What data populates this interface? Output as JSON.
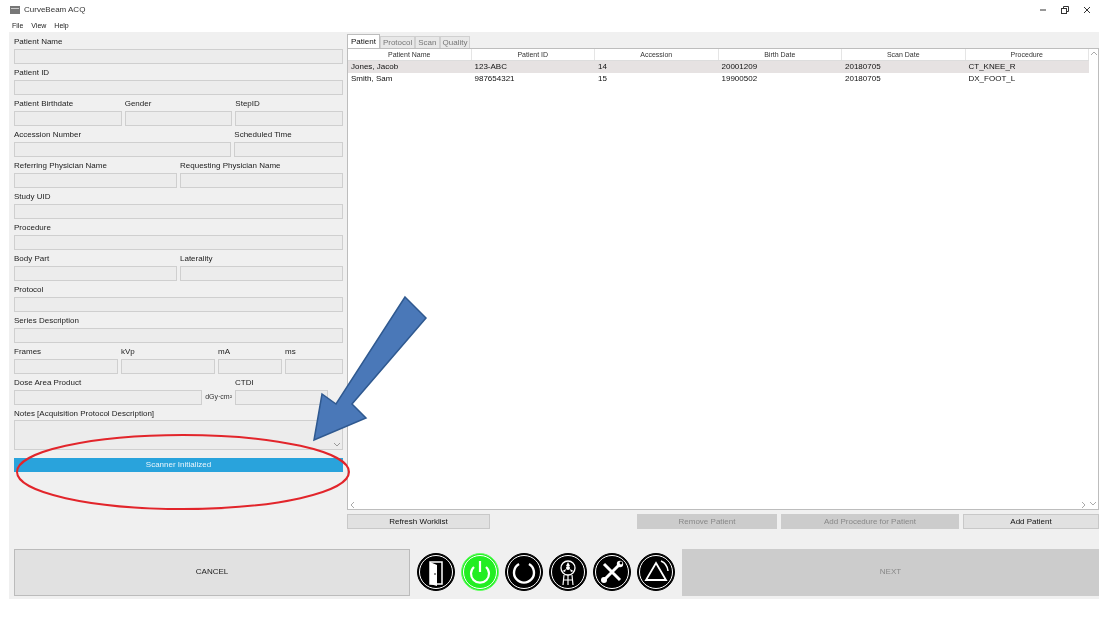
{
  "window": {
    "title": "CurveBeam ACQ"
  },
  "menu": [
    "File",
    "View",
    "Help"
  ],
  "form": {
    "lines": [
      {
        "fields": [
          {
            "label": "Patient Name"
          }
        ]
      },
      {
        "fields": [
          {
            "label": "Patient ID"
          }
        ]
      },
      {
        "fields": [
          {
            "label": "Patient Birthdate"
          },
          {
            "label": "Gender"
          },
          {
            "label": "StepID"
          }
        ]
      },
      {
        "fields": [
          {
            "label": "Accession Number"
          },
          {
            "label": "Scheduled Time"
          }
        ]
      },
      {
        "fields": [
          {
            "label": "Referring Physician Name"
          },
          {
            "label": "Requesting Physician Name"
          }
        ]
      },
      {
        "fields": [
          {
            "label": "Study UID"
          }
        ]
      },
      {
        "fields": [
          {
            "label": "Procedure"
          }
        ]
      },
      {
        "fields": [
          {
            "label": "Body Part"
          },
          {
            "label": "Laterality"
          }
        ]
      },
      {
        "fields": [
          {
            "label": "Protocol"
          }
        ]
      },
      {
        "fields": [
          {
            "label": "Series Description"
          }
        ]
      },
      {
        "fields": [
          {
            "label": "Frames"
          },
          {
            "label": "kVp"
          },
          {
            "label": "mA"
          },
          {
            "label": "ms"
          }
        ]
      },
      {
        "fields": [
          {
            "label": "Dose Area Product",
            "unit": "dGy·cm²"
          },
          {
            "label": "CTDI"
          }
        ]
      }
    ],
    "notes_label": "Notes [Acquisition Protocol Description]",
    "status": "Scanner Initialized"
  },
  "tabs": [
    {
      "label": "Patient",
      "selected": true
    },
    {
      "label": "Protocol",
      "selected": false
    },
    {
      "label": "Scan",
      "selected": false
    },
    {
      "label": "Quality",
      "selected": false
    }
  ],
  "table": {
    "columns": [
      "Patient Name",
      "Patient ID",
      "Accession",
      "Birth Date",
      "Scan Date",
      "Procedure"
    ],
    "rows": [
      {
        "cells": [
          "Jones, Jacob",
          "123-ABC",
          "14",
          "20001209",
          "20180705",
          "CT_KNEE_R"
        ],
        "selected": true
      },
      {
        "cells": [
          "Smith, Sam",
          "987654321",
          "15",
          "19900502",
          "20180705",
          "DX_FOOT_L"
        ],
        "selected": false
      }
    ]
  },
  "worklist_buttons": [
    {
      "label": "Refresh Worklist",
      "disabled": false
    },
    {
      "label": "Remove Patient",
      "disabled": true
    },
    {
      "label": "Add Procedure for Patient",
      "disabled": true
    },
    {
      "label": "Add Patient",
      "disabled": false
    }
  ],
  "footer": {
    "cancel": {
      "label": "CANCEL"
    },
    "icon_buttons": [
      {
        "kind": "door",
        "active": false
      },
      {
        "kind": "power",
        "active": true
      },
      {
        "kind": "ring",
        "active": false
      },
      {
        "kind": "tube",
        "active": false
      },
      {
        "kind": "tools",
        "active": false
      },
      {
        "kind": "warning",
        "active": false
      }
    ],
    "next": {
      "label": "NEXT",
      "disabled": true
    }
  },
  "annotations": {
    "arrow": true,
    "ellipse": true
  }
}
